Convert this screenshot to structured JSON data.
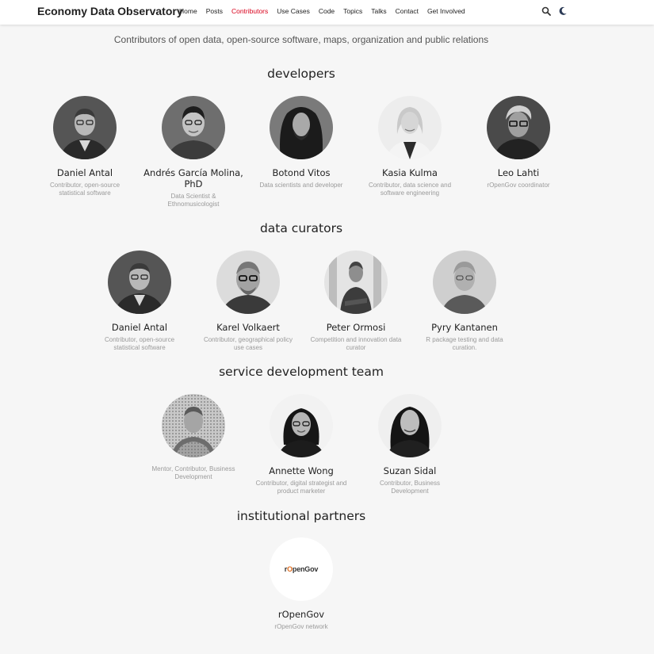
{
  "header": {
    "brand": "Economy Data Observatory",
    "nav": [
      {
        "label": "Home",
        "active": false
      },
      {
        "label": "Posts",
        "active": false
      },
      {
        "label": "Contributors",
        "active": true
      },
      {
        "label": "Use Cases",
        "active": false
      },
      {
        "label": "Code",
        "active": false
      },
      {
        "label": "Topics",
        "active": false
      },
      {
        "label": "Talks",
        "active": false
      },
      {
        "label": "Contact",
        "active": false
      },
      {
        "label": "Get Involved",
        "active": false
      }
    ],
    "icons": [
      "search-icon",
      "moon-icon"
    ],
    "active_color": "#d9001b"
  },
  "tagline": "Contributors of open data, open-source software, maps, organization and public relations",
  "sections": {
    "developers": {
      "title": "developers",
      "people": [
        {
          "name": "Daniel Antal",
          "role": "Contributor, open-source statistical software"
        },
        {
          "name": "Andrés García Molina, PhD",
          "role": "Data Scientist & Ethnomusicologist"
        },
        {
          "name": "Botond Vitos",
          "role": "Data scientists and developer"
        },
        {
          "name": "Kasia Kulma",
          "role": "Contributor, data science and software engineering"
        },
        {
          "name": "Leo Lahti",
          "role": "rOpenGov coordinator"
        }
      ]
    },
    "curators": {
      "title": "data curators",
      "people": [
        {
          "name": "Daniel Antal",
          "role": "Contributor, open-source statistical software"
        },
        {
          "name": "Karel Volkaert",
          "role": "Contributor, geographical policy use cases"
        },
        {
          "name": "Peter Ormosi",
          "role": "Competition and innovation data curator"
        },
        {
          "name": "Pyry Kantanen",
          "role": "R package testing and data curation."
        }
      ]
    },
    "service": {
      "title": "service development team",
      "people": [
        {
          "name": "",
          "role": "Mentor, Contributor, Business Development"
        },
        {
          "name": "Annette Wong",
          "role": "Contributor, digital strategist and product marketer"
        },
        {
          "name": "Suzan Sidal",
          "role": "Contributor, Business Development"
        }
      ]
    },
    "partners": {
      "title": "institutional partners",
      "logo_text": "rOpenGov",
      "logo_accent_color": "#e06d1f",
      "name": "rOpenGov",
      "role": "rOpenGov network"
    }
  }
}
